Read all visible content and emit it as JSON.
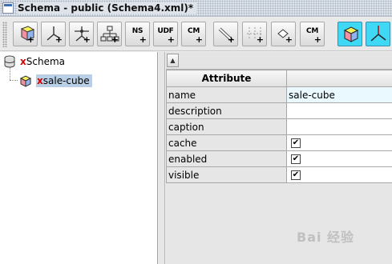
{
  "window": {
    "title": "Schema - public (Schema4.xml)*"
  },
  "toolbar": {
    "buttons": [
      {
        "name": "add-cube",
        "icon": "cube-plus-icon"
      },
      {
        "name": "add-dimension",
        "icon": "dimension-plus-icon"
      },
      {
        "name": "add-measure",
        "icon": "measure-plus-icon"
      },
      {
        "name": "add-hierarchy",
        "icon": "hierarchy-plus-icon"
      },
      {
        "name": "add-named-set",
        "label": "NS"
      },
      {
        "name": "add-udf",
        "label": "UDF"
      },
      {
        "name": "add-calculated-member",
        "label": "CM"
      },
      {
        "name": "add-level",
        "icon": "level-plus-icon"
      },
      {
        "name": "add-property",
        "icon": "property-plus-icon"
      },
      {
        "name": "add-closure",
        "icon": "closure-plus-icon"
      },
      {
        "name": "add-cube-calculated-member",
        "label": "CM"
      },
      {
        "name": "cube-view",
        "icon": "cube-icon",
        "active": true
      },
      {
        "name": "dimension-view",
        "icon": "dimension-icon",
        "active": true
      }
    ],
    "labels": {
      "ns": "NS",
      "udf": "UDF",
      "cm": "CM",
      "cm2": "CM",
      "plus": "+"
    }
  },
  "tree": {
    "root": {
      "prefix": "x",
      "label": "Schema"
    },
    "children": [
      {
        "prefix": "x",
        "label": "sale-cube",
        "selected": true
      }
    ]
  },
  "properties": {
    "header": "Attribute",
    "rows": [
      {
        "key": "name",
        "value": "sale-cube",
        "type": "text"
      },
      {
        "key": "description",
        "value": "",
        "type": "text"
      },
      {
        "key": "caption",
        "value": "",
        "type": "text"
      },
      {
        "key": "cache",
        "value": "✔",
        "type": "checkbox"
      },
      {
        "key": "enabled",
        "value": "✔",
        "type": "checkbox"
      },
      {
        "key": "visible",
        "value": "✔",
        "type": "checkbox"
      }
    ]
  },
  "colors": {
    "accent": "#3fd8f5",
    "selection": "#b8cfe5",
    "error_prefix": "#d40000"
  },
  "watermark": "Bai 经验"
}
